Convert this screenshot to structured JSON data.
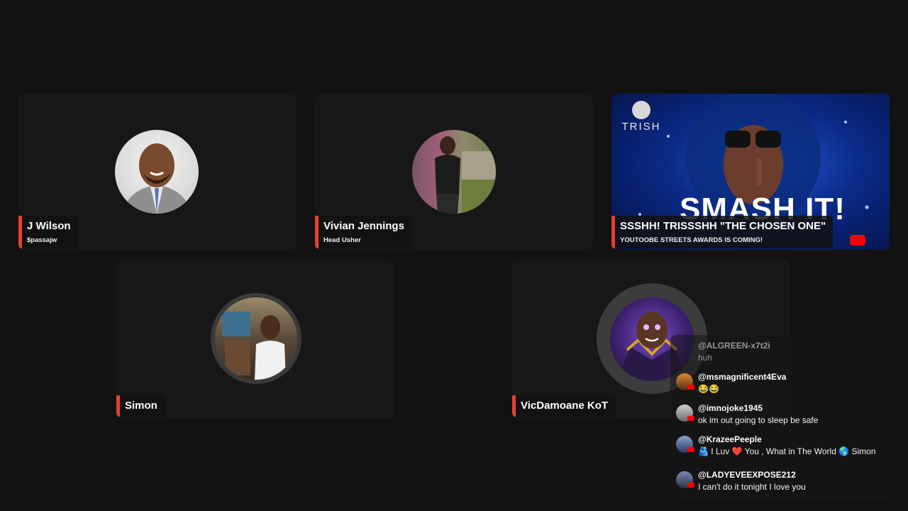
{
  "participants": [
    {
      "name": "J Wilson",
      "subtitle": "$passajw"
    },
    {
      "name": "Vivian Jennings",
      "subtitle": "Head Usher"
    },
    {
      "name": "Simon"
    },
    {
      "name": "VicDamoane KoT"
    }
  ],
  "banner": {
    "logo_text": "TRISH",
    "headline": "SMASH IT!",
    "title": "SSSHH! TRISSSHH \"THE CHOSEN ONE\"",
    "subtitle": "YOUTOOBE STREETS AWARDS IS COMING!"
  },
  "chat": {
    "messages": [
      {
        "user": "@ALGREEN-x7t2i",
        "text": "huh"
      },
      {
        "user": "@msmagnificent4Eva",
        "text": "😂😂"
      },
      {
        "user": "@imnojoke1945",
        "text": "ok im out going to sleep be safe"
      },
      {
        "user": "@KrazeePeeple",
        "text": "🫂 I Luv ❤️ You , What in The World 🌎 Simon"
      },
      {
        "user": "@LADYEVEEXPOSE212",
        "text": "I can't do it tonight I love you"
      }
    ]
  },
  "colors": {
    "accent": "#e8412b",
    "background": "#121212",
    "tile": "#171717"
  }
}
